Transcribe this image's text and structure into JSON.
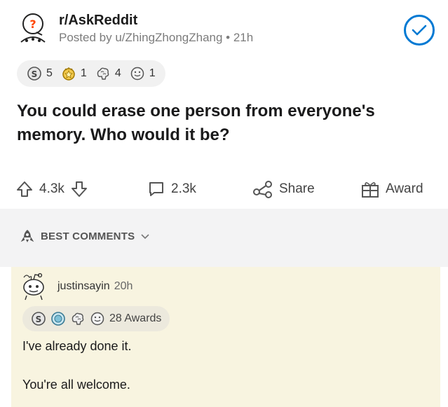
{
  "post": {
    "subreddit": "r/AskReddit",
    "posted_by": "Posted by u/ZhingZhongZhang • 21h",
    "awards": [
      {
        "icon": "silver-award-icon",
        "count": "5"
      },
      {
        "icon": "gold-award-icon",
        "count": "1"
      },
      {
        "icon": "brain-award-icon",
        "count": "4"
      },
      {
        "icon": "wholesome-award-icon",
        "count": "1"
      }
    ],
    "title": "You could erase one person from everyone's memory. Who would it be?",
    "upvotes": "4.3k",
    "comments": "2.3k",
    "share_label": "Share",
    "award_label": "Award"
  },
  "sort": {
    "label": "BEST COMMENTS"
  },
  "comment": {
    "username": "justinsayin",
    "time": "20h",
    "awards_label": "28 Awards",
    "line1": "I've already done it.",
    "line2": "You're all welcome."
  },
  "colors": {
    "accent": "#0079d3",
    "comment_bg": "#f8f4e0",
    "band_bg": "#f3f3f4"
  }
}
